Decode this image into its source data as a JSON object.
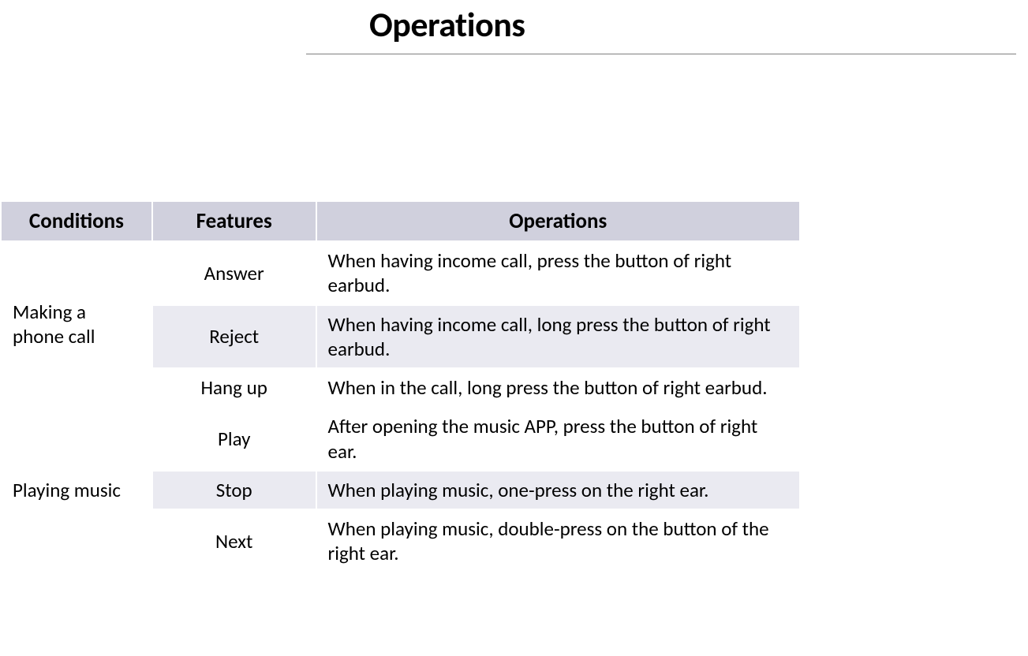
{
  "page": {
    "title": "Operations"
  },
  "table": {
    "headers": {
      "conditions": "Conditions",
      "features": "Features",
      "operations": "Operations"
    },
    "groups": [
      {
        "condition": "Making a phone call",
        "rows": [
          {
            "feature": "Answer",
            "operation": "When having income call, press the button of right earbud."
          },
          {
            "feature": "Reject",
            "operation": "When having income call, long press the button of right earbud."
          },
          {
            "feature": "Hang up",
            "operation": "When in the call, long press the button of right earbud."
          }
        ]
      },
      {
        "condition": "Playing music",
        "rows": [
          {
            "feature": "Play",
            "operation": "After opening the music APP, press the button of right ear."
          },
          {
            "feature": "Stop",
            "operation": "When playing music, one-press on the right ear."
          },
          {
            "feature": "Next",
            "operation": "When playing music, double-press on the button of the right ear."
          }
        ]
      }
    ]
  }
}
